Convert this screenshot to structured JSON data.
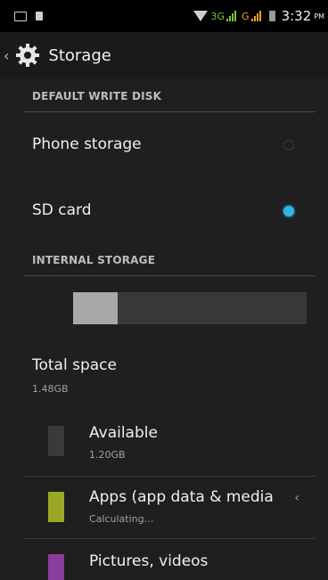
{
  "status_bar": {
    "network_3g": "3G",
    "network_g": "G",
    "time": "3:32",
    "ampm": "PM"
  },
  "action_bar": {
    "title": "Storage",
    "icon": "gear-icon"
  },
  "sections": {
    "default_write_disk": "DEFAULT WRITE DISK",
    "internal_storage": "INTERNAL STORAGE"
  },
  "write_disk": {
    "phone_storage": {
      "label": "Phone storage",
      "selected": false
    },
    "sd_card": {
      "label": "SD card",
      "selected": true
    }
  },
  "usage": {
    "used_fraction": 0.19,
    "used_color": "#a8a8a8",
    "free_color": "#383838"
  },
  "total": {
    "label": "Total space",
    "value": "1.48GB"
  },
  "items": [
    {
      "title": "Available",
      "subtitle": "1.20GB",
      "color": "#3a3a3a"
    },
    {
      "title": "Apps (app data & media",
      "subtitle": "Calculating…",
      "color": "#9aa825"
    },
    {
      "title": "Pictures, videos",
      "subtitle": "",
      "color": "#8a3d9a"
    }
  ],
  "colors": {
    "accent": "#33b5e5",
    "background": "#1f1f1f"
  }
}
